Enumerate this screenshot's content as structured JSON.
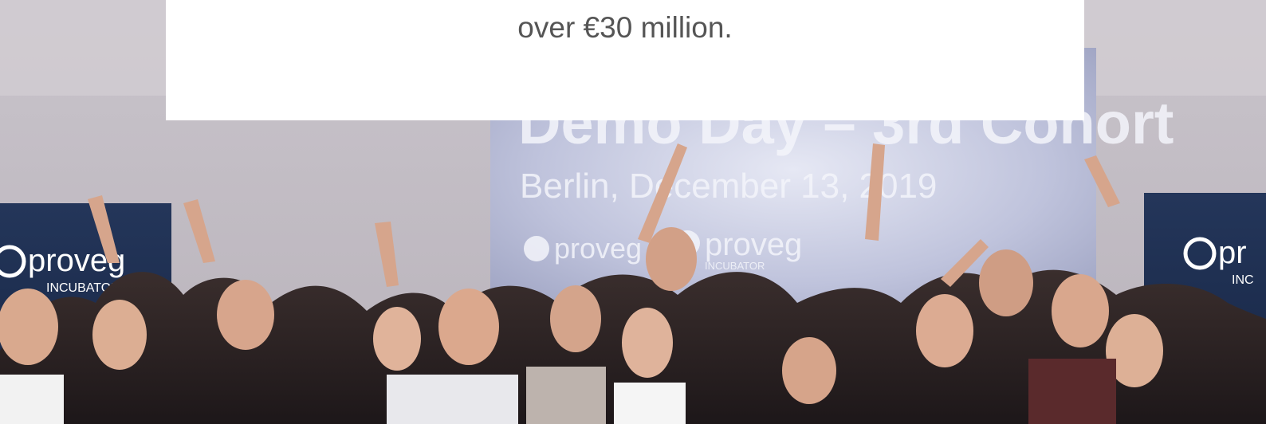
{
  "hero": {
    "card_text": "over €30 million.",
    "photo_description_icon": "group-photo",
    "banner_left_logo": "proveg INCUBATOR",
    "banner_right_logo": "proveg INCUBATOR",
    "screen_logo": "proveg INCUBATOR",
    "screen_subtitle": "Berlin, December 13, 2019",
    "screen_title": "Demo Day – 3rd Cohort"
  },
  "colors": {
    "card_background": "#ffffff",
    "card_text": "#555555",
    "banner_navy": "#1b2d4f",
    "screen_glow": "#cfd3e6",
    "wall": "#d8d4d8"
  }
}
